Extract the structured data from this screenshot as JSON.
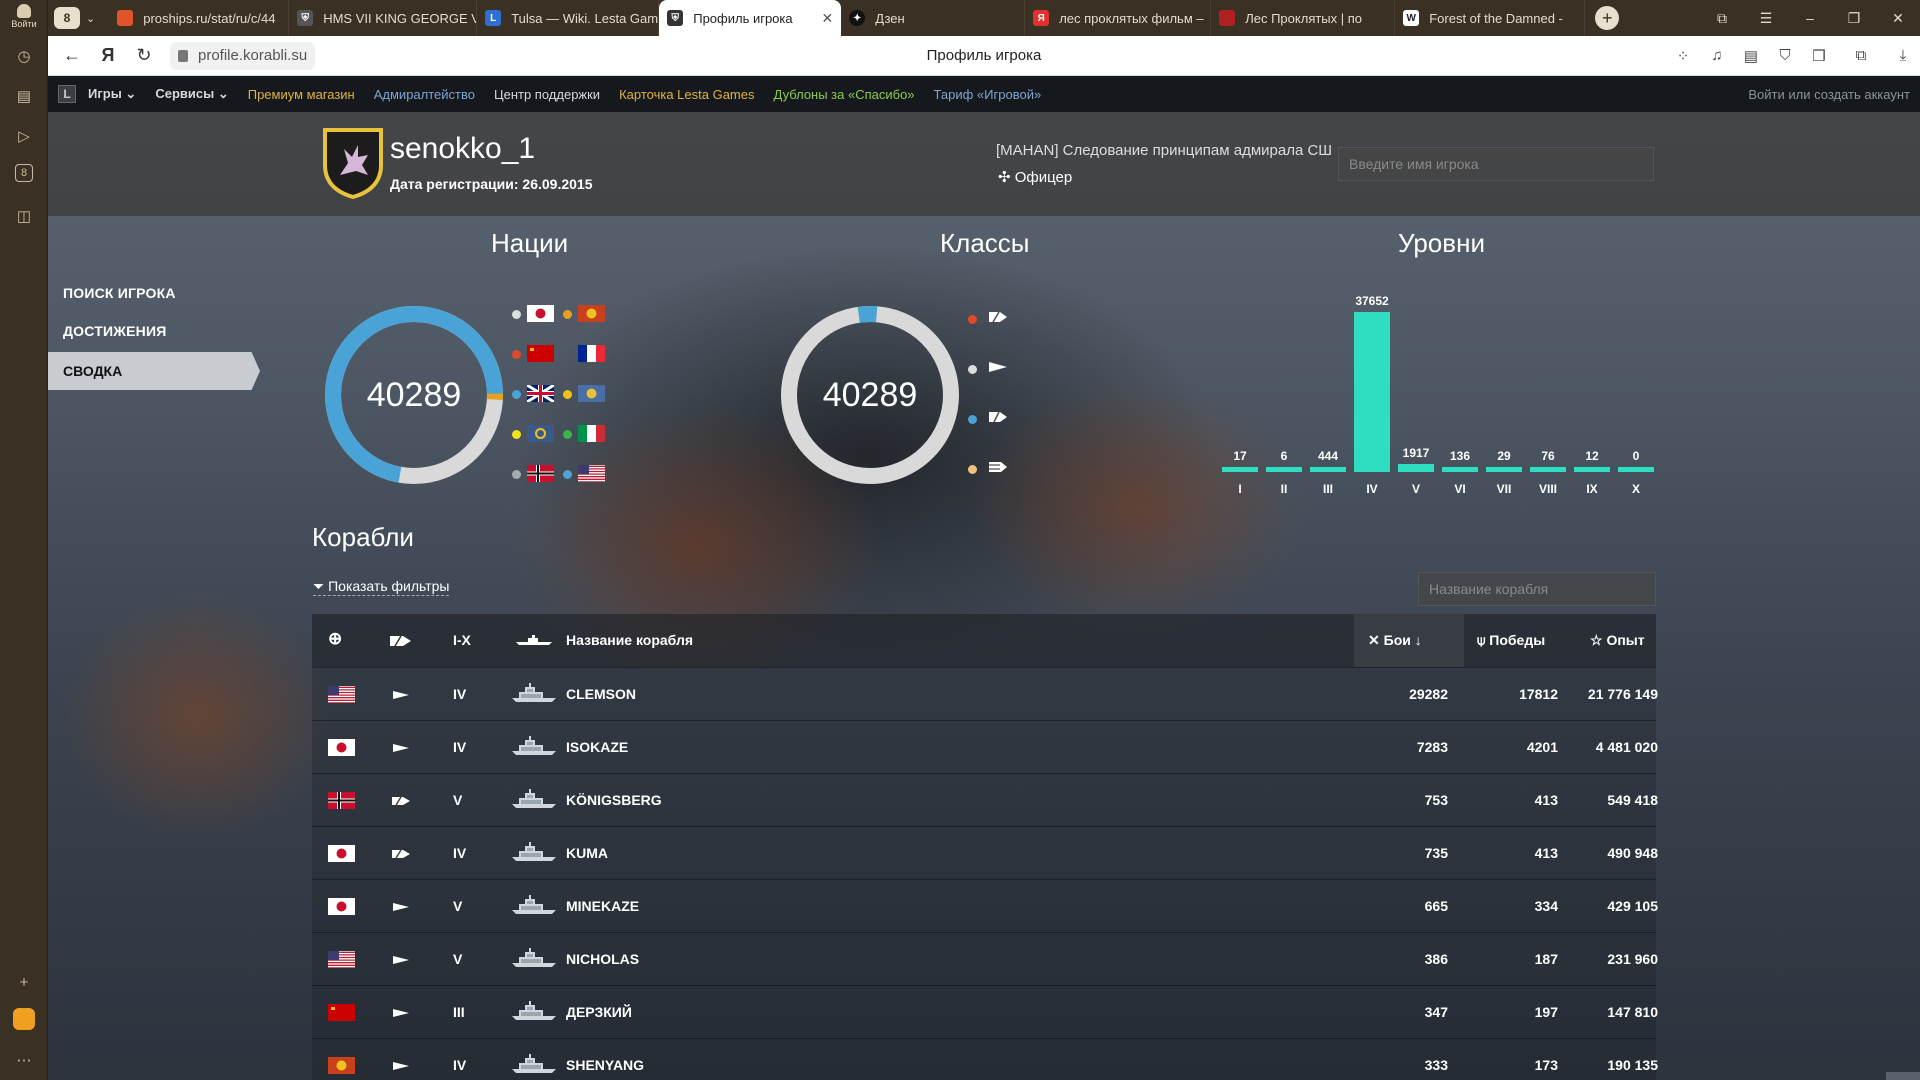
{
  "browser": {
    "login_label": "Войти",
    "tab_count": "8",
    "tabs": [
      {
        "title": "proships.ru/stat/ru/c/44",
        "fav_color": "#e0542a"
      },
      {
        "title": "HMS VII KING GEORGE V",
        "fav_color": "#555555"
      },
      {
        "title": "Tulsa — Wiki. Lesta Gam",
        "fav_color": "#2f6fd1"
      },
      {
        "title": "Профиль игрока",
        "fav_color": "#333333"
      },
      {
        "title": "Дзен",
        "fav_color": "#111111"
      },
      {
        "title": "лес проклятых фильм –",
        "fav_color": "#e03030"
      },
      {
        "title": "Лес Проклятых | по",
        "fav_color": "#b02020"
      },
      {
        "title": "Forest of the Damned -",
        "fav_color": "#ffffff"
      }
    ],
    "url": "profile.korabli.su",
    "page_title": "Профиль игрока"
  },
  "nav": {
    "items": [
      "Игры",
      "Сервисы",
      "Премиум магазин",
      "Адмиралтейство",
      "Центр поддержки",
      "Карточка Lesta Games",
      "Дублоны за «Спасибо»",
      "Тариф «Игровой»"
    ],
    "login": "Войти",
    "or": "или",
    "create": "создать аккаунт"
  },
  "player": {
    "name": "senokko_1",
    "reg": "Дата регистрации: 26.09.2015",
    "clan": "[MAHAN] Следование принципам адмирала СШ",
    "rank": "Офицер",
    "search_placeholder": "Введите имя игрока"
  },
  "sidemenu": [
    "ПОИСК ИГРОКА",
    "ДОСТИЖЕНИЯ",
    "СВОДКА"
  ],
  "sections": {
    "nations": "Нации",
    "classes": "Классы",
    "tiers": "Уровни",
    "ships": "Корабли"
  },
  "nations_total": "40289",
  "classes_total": "40289",
  "colors": {
    "accent": "#2ddfc0",
    "donut": "#4aa3d6",
    "donut_rest": "#d9d9d9"
  },
  "chart_data": {
    "type": "bar",
    "categories": [
      "I",
      "II",
      "III",
      "IV",
      "V",
      "VI",
      "VII",
      "VIII",
      "IX",
      "X"
    ],
    "values": [
      17,
      6,
      444,
      37652,
      1917,
      136,
      29,
      76,
      12,
      0
    ],
    "title": "Уровни"
  },
  "ships": {
    "filters_label": "Показать фильтры",
    "search_placeholder": "Название корабля",
    "headers": {
      "tier": "I-X",
      "name": "Название корабля",
      "battles": "Бои",
      "wins": "Победы",
      "xp": "Опыт"
    },
    "rows": [
      {
        "nation": "usa",
        "cls": "destroyer",
        "tier": "IV",
        "name": "CLEMSON",
        "battles": "29282",
        "wins": "17812",
        "xp": "21 776 149"
      },
      {
        "nation": "japan",
        "cls": "destroyer",
        "tier": "IV",
        "name": "ISOKAZE",
        "battles": "7283",
        "wins": "4201",
        "xp": "4 481 020"
      },
      {
        "nation": "germany",
        "cls": "cruiser",
        "tier": "V",
        "name": "KÖNIGSBERG",
        "battles": "753",
        "wins": "413",
        "xp": "549 418"
      },
      {
        "nation": "japan",
        "cls": "cruiser",
        "tier": "IV",
        "name": "KUMA",
        "battles": "735",
        "wins": "413",
        "xp": "490 948"
      },
      {
        "nation": "japan",
        "cls": "destroyer",
        "tier": "V",
        "name": "MINEKAZE",
        "battles": "665",
        "wins": "334",
        "xp": "429 105"
      },
      {
        "nation": "usa",
        "cls": "destroyer",
        "tier": "V",
        "name": "NICHOLAS",
        "battles": "386",
        "wins": "187",
        "xp": "231 960"
      },
      {
        "nation": "ussr",
        "cls": "destroyer",
        "tier": "III",
        "name": "ДЕРЗКИЙ",
        "battles": "347",
        "wins": "197",
        "xp": "147 810"
      },
      {
        "nation": "panasia",
        "cls": "destroyer",
        "tier": "IV",
        "name": "SHENYANG",
        "battles": "333",
        "wins": "173",
        "xp": "190 135"
      }
    ]
  }
}
